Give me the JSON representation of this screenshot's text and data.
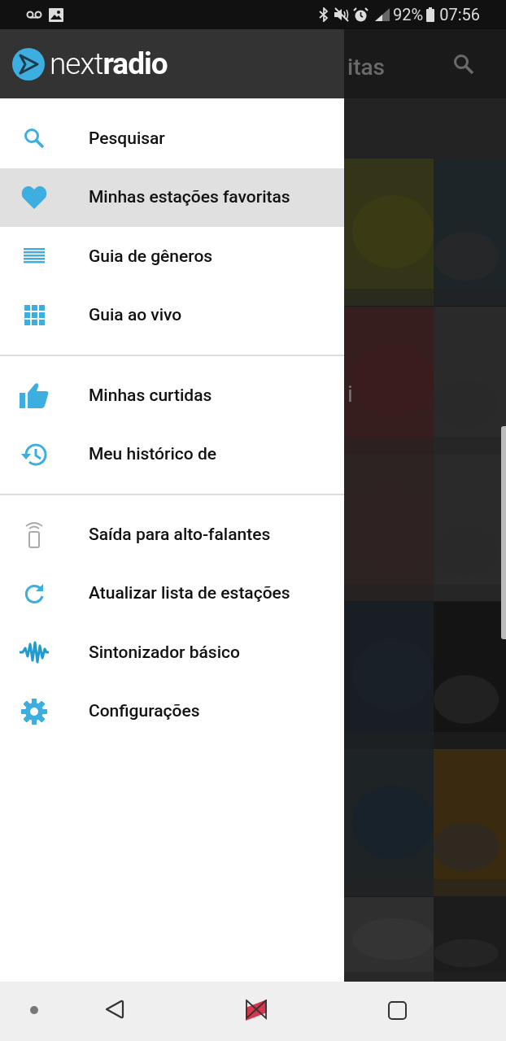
{
  "status_bar": {
    "battery": "92%",
    "time": "07:56"
  },
  "background_app": {
    "title_fragment": "itas",
    "card_text_fragment": "i"
  },
  "drawer": {
    "logo": {
      "light": "next",
      "bold": "radio"
    },
    "sections": [
      [
        {
          "kind": "search",
          "label": "Pesquisar",
          "selected": false
        },
        {
          "kind": "heart",
          "label": "Minhas estações favoritas",
          "selected": true
        },
        {
          "kind": "list",
          "label": "Guia de gêneros",
          "selected": false
        },
        {
          "kind": "grid",
          "label": "Guia ao vivo",
          "selected": false
        }
      ],
      [
        {
          "kind": "thumb",
          "label": "Minhas curtidas",
          "selected": false
        },
        {
          "kind": "history",
          "label": "Meu histórico de",
          "selected": false
        }
      ],
      [
        {
          "kind": "speaker",
          "label": "Saída para alto-falantes",
          "selected": false
        },
        {
          "kind": "refresh",
          "label": "Atualizar lista de estações",
          "selected": false
        },
        {
          "kind": "wave",
          "label": "Sintonizador básico",
          "selected": false
        },
        {
          "kind": "gear",
          "label": "Configurações",
          "selected": false
        }
      ]
    ]
  }
}
